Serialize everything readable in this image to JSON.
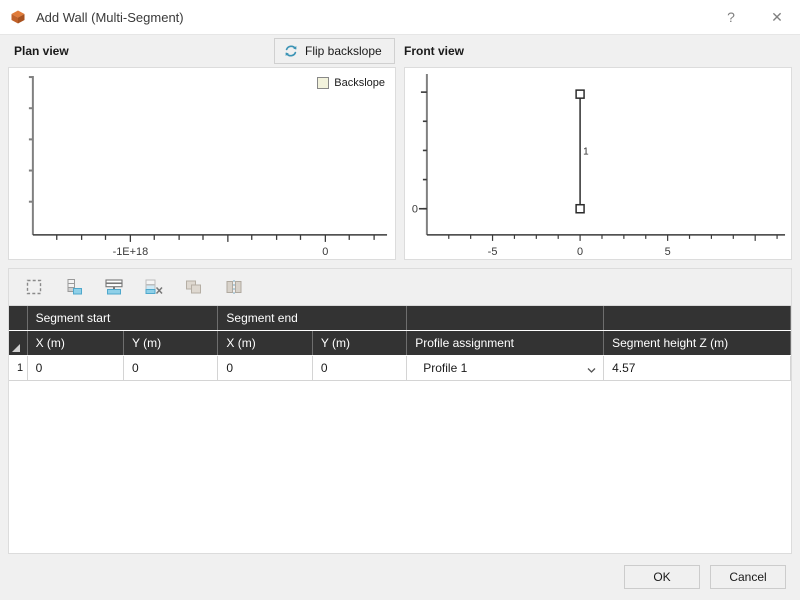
{
  "window": {
    "title": "Add Wall (Multi-Segment)",
    "app_icon": "cube-icon",
    "help_label": "?",
    "close_label": "✕"
  },
  "views": {
    "plan_label": "Plan view",
    "front_label": "Front view",
    "flip_button": {
      "label": "Flip backslope",
      "icon": "refresh-icon",
      "icon_color": "#3b93b5"
    },
    "plan_legend": {
      "label": "Backslope",
      "swatch_color": "#f2f2dc"
    }
  },
  "chart_data": [
    {
      "type": "scatter",
      "title": "Plan view",
      "xlabel": "",
      "ylabel": "",
      "x_ticks": [
        {
          "value": -1e+18,
          "label": "-1E+18"
        },
        {
          "value": 0,
          "label": "0"
        }
      ],
      "y_ticks": [],
      "xlim": [
        -1.9e+18,
        1.35e+18
      ],
      "ylim": [
        0,
        1
      ],
      "grid": false,
      "legend": [
        "Backslope"
      ],
      "legend_position": "top-right",
      "series": []
    },
    {
      "type": "line",
      "title": "Front view",
      "xlabel": "",
      "ylabel": "",
      "x_ticks": [
        {
          "value": -5,
          "label": "-5"
        },
        {
          "value": 0,
          "label": "0"
        },
        {
          "value": 5,
          "label": "5"
        }
      ],
      "y_ticks": [
        {
          "value": 0,
          "label": "0"
        }
      ],
      "xlim": [
        -8.2,
        8.2
      ],
      "ylim": [
        -0.55,
        5.3
      ],
      "grid": false,
      "series": [
        {
          "name": "1",
          "label": "1",
          "x": [
            0,
            0
          ],
          "y": [
            0,
            4.57
          ],
          "marker": "square"
        }
      ]
    }
  ],
  "toolbar": {
    "buttons": [
      {
        "name": "select-all-icon",
        "label": "Select all"
      },
      {
        "name": "insert-row-below-icon",
        "label": "Insert row"
      },
      {
        "name": "insert-row-icon",
        "label": "Add row"
      },
      {
        "name": "delete-row-icon",
        "label": "Delete row"
      },
      {
        "name": "copy-icon",
        "label": "Copy"
      },
      {
        "name": "mirror-icon",
        "label": "Mirror"
      }
    ]
  },
  "table": {
    "group_headers": [
      {
        "label": "Segment start",
        "span": 2
      },
      {
        "label": "Segment end",
        "span": 2
      }
    ],
    "columns": [
      "X (m)",
      "Y (m)",
      "X (m)",
      "Y (m)",
      "Profile assignment",
      "Segment height Z (m)"
    ],
    "rows": [
      {
        "number": "1",
        "start_x": "0",
        "start_y": "0",
        "end_x": "0",
        "end_y": "0",
        "profile": "Profile 1",
        "height_z": "4.57"
      }
    ]
  },
  "footer": {
    "ok_label": "OK",
    "cancel_label": "Cancel"
  }
}
